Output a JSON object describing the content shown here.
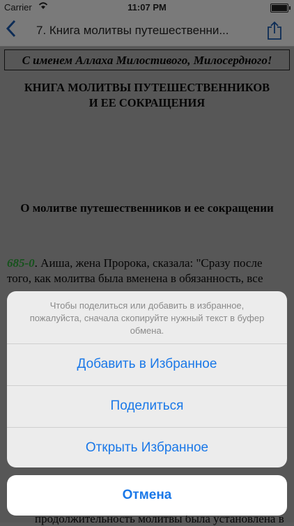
{
  "status_bar": {
    "carrier": "Carrier",
    "time": "11:07 PM"
  },
  "nav": {
    "back_icon": "chevron-left-icon",
    "title": "7. Книга молитвы путешественни...",
    "share_icon": "share-icon"
  },
  "content": {
    "bismillah": "С именем Аллаха Милостивого, Милосердного!",
    "heading_line1": "КНИГА МОЛИТВЫ ПУТЕШЕСТВЕННИКОВ",
    "heading_line2": "И ЕЕ СОКРАЩЕНИЯ",
    "subheading": "О молитве путешественников и ее сокращении",
    "hadith_number": "685-0",
    "hadith_text": ". Аиша, жена Пророка, сказала: \"Сразу после того, как молитва была вменена в обязанность, все",
    "bottom_line": "продолжительность молитвы была установлена в"
  },
  "action_sheet": {
    "message": "Чтобы поделиться или добавить в избранное, пожалуйста, сначала скопируйте нужный текст в буфер обмена.",
    "actions": [
      "Добавить в Избранное",
      "Поделиться",
      "Открыть Избранное"
    ],
    "cancel": "Отмена"
  }
}
